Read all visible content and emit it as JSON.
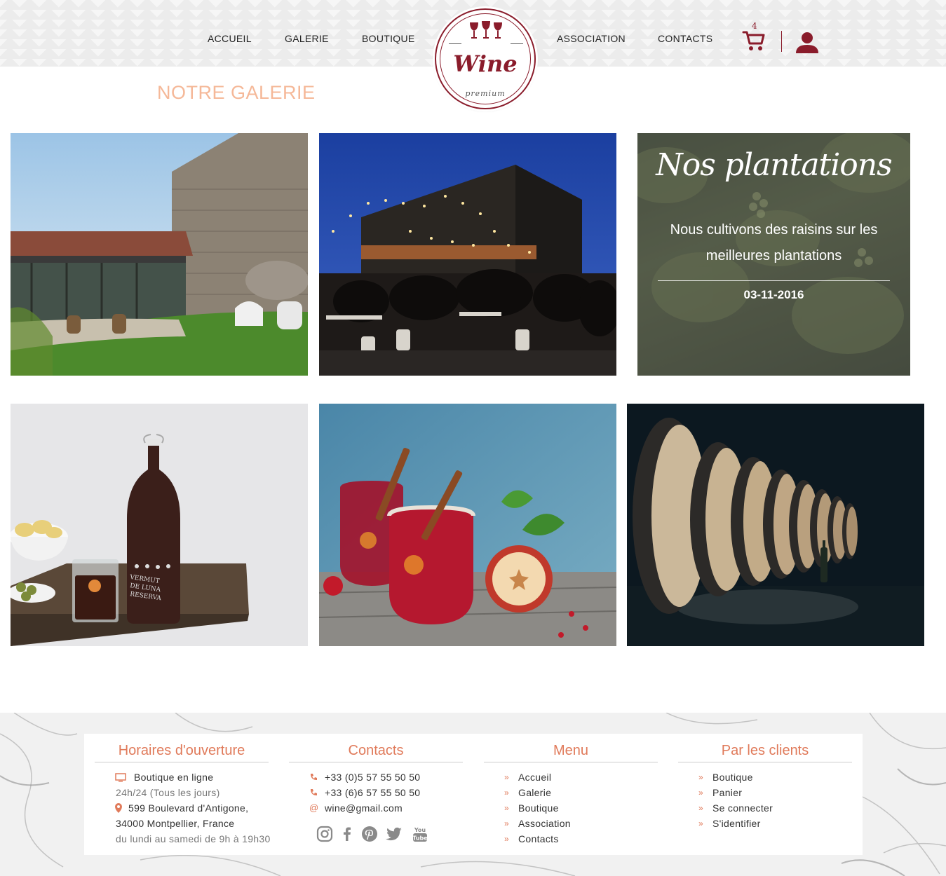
{
  "nav": {
    "left": [
      "ACCUEIL",
      "GALERIE",
      "BOUTIQUE"
    ],
    "right": [
      "ASSOCIATION",
      "CONTACTS"
    ],
    "cart_count": "4"
  },
  "logo": {
    "word": "Wine",
    "sub": "premium"
  },
  "icons": [
    "wine-glasses-icon",
    "cart-icon",
    "user-icon"
  ],
  "gallery": {
    "title": "NOTRE GALERIE",
    "feature": {
      "heading": "Nos plantations",
      "text": "Nous cultivons des raisins sur les meilleures plantations",
      "date": "03-11-2016"
    }
  },
  "footer": {
    "hours": {
      "title": "Horaires d'ouverture",
      "online": "Boutique en ligne",
      "online_hours": "24h/24 (Tous les jours)",
      "address1": "599 Boulevard d'Antigone,",
      "address2": "34000 Montpellier, France",
      "shop_hours": "du lundi au samedi de 9h à 19h30"
    },
    "contacts": {
      "title": "Contacts",
      "phone1": "+33 (0)5 57 55 50 50",
      "phone2": "+33 (6)6 57 55 50 50",
      "email": "wine@gmail.com",
      "social": [
        "instagram-icon",
        "facebook-icon",
        "pinterest-icon",
        "twitter-icon",
        "youtube-icon"
      ]
    },
    "menu": {
      "title": "Menu",
      "items": [
        "Accueil",
        "Galerie",
        "Boutique",
        "Association",
        "Contacts"
      ]
    },
    "clients": {
      "title": "Par les clients",
      "items": [
        "Boutique",
        "Panier",
        "Se connecter",
        "S'identifier"
      ]
    }
  },
  "colors": {
    "brand": "#8a1c2b",
    "accent": "#e07a5a",
    "gallery_title": "#f5b898"
  }
}
